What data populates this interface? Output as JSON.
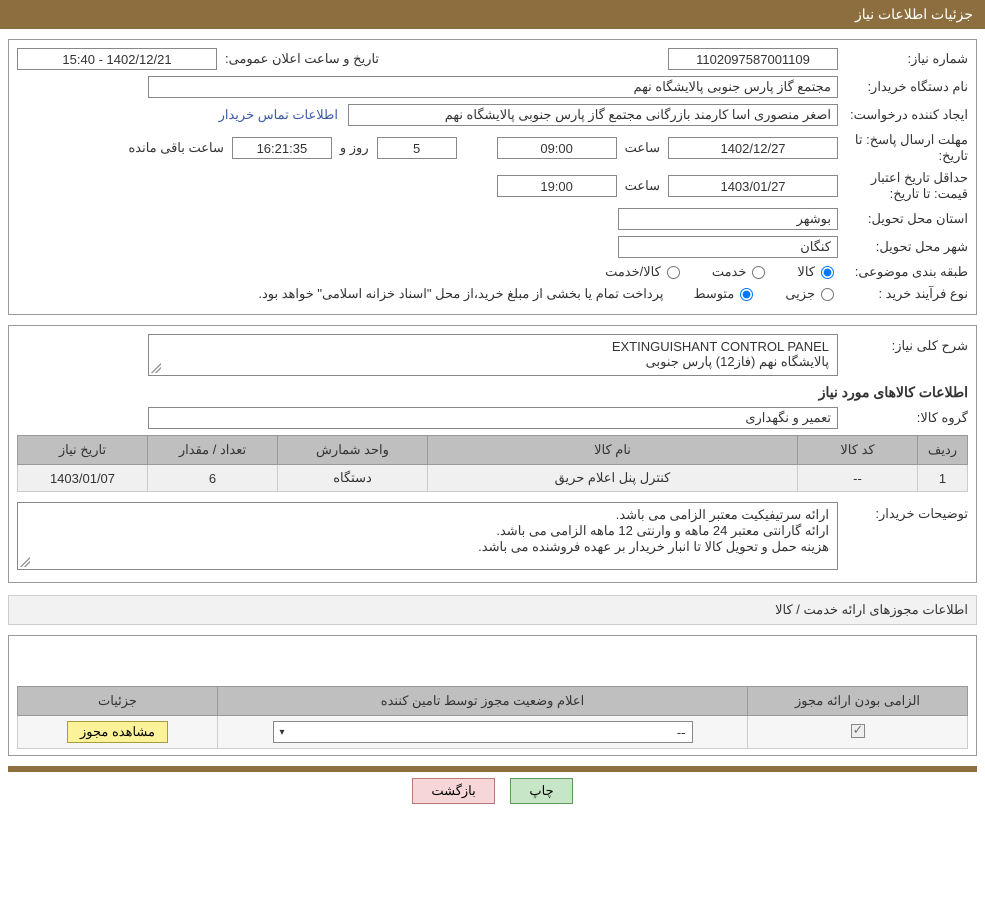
{
  "header": {
    "title": "جزئیات اطلاعات نیاز"
  },
  "labels": {
    "need_no": "شماره نیاز:",
    "announce_dt": "تاریخ و ساعت اعلان عمومی:",
    "buyer_org": "نام دستگاه خریدار:",
    "requester": "ایجاد کننده درخواست:",
    "buyer_contact": "اطلاعات تماس خریدار",
    "reply_deadline": "مهلت ارسال پاسخ:",
    "to_date": "تا تاریخ:",
    "hour": "ساعت",
    "days_and": "روز و",
    "remaining": "ساعت باقی مانده",
    "price_validity": "حداقل تاریخ اعتبار قیمت:",
    "province": "استان محل تحویل:",
    "city": "شهر محل تحویل:",
    "category": "طبقه بندی موضوعی:",
    "cat_goods": "کالا",
    "cat_service": "خدمت",
    "cat_goods_service": "کالا/خدمت",
    "purchase_type": "نوع فرآیند خرید :",
    "pt_partial": "جزیی",
    "pt_medium": "متوسط",
    "payment_note": "پرداخت تمام یا بخشی از مبلغ خرید،از محل \"اسناد خزانه اسلامی\" خواهد بود.",
    "general_desc": "شرح کلی نیاز:",
    "items_title": "اطلاعات کالاهای مورد نیاز",
    "goods_group": "گروه کالا:",
    "buyer_notes": "توضیحات خریدار:",
    "licenses_title": "اطلاعات مجوزهای ارائه خدمت / کالا",
    "view_license": "مشاهده مجوز",
    "print": "چاپ",
    "back": "بازگشت"
  },
  "values": {
    "need_no": "1102097587001109",
    "announce_dt": "1402/12/21 - 15:40",
    "buyer_org": "مجتمع گاز پارس جنوبی  پالایشگاه نهم",
    "requester": "اصغر منصوری اسا کارمند بازرگانی مجتمع گاز پارس جنوبی  پالایشگاه نهم",
    "reply_date": "1402/12/27",
    "reply_time": "09:00",
    "days_left": "5",
    "time_left": "16:21:35",
    "validity_date": "1403/01/27",
    "validity_time": "19:00",
    "province": "بوشهر",
    "city": "کنگان",
    "desc_line1": "EXTINGUISHANT CONTROL PANEL",
    "desc_line2": "پالایشگاه نهم (فاز12) پارس جنوبی",
    "goods_group": "تعمیر و نگهداری",
    "notes_l1": "ارائه سرتیفیکیت معتبر الزامی می باشد.",
    "notes_l2": "ارائه گارانتی معتبر 24 ماهه و وارنتی 12 ماهه الزامی می باشد.",
    "notes_l3": "هزینه حمل و تحویل کالا تا انبار خریدار بر عهده فروشنده می باشد.",
    "dropdown_placeholder": "--"
  },
  "items_table": {
    "headers": {
      "row": "ردیف",
      "code": "کد کالا",
      "name": "نام کالا",
      "unit": "واحد شمارش",
      "qty": "تعداد / مقدار",
      "need_date": "تاریخ نیاز"
    },
    "rows": [
      {
        "row": "1",
        "code": "--",
        "name": "کنترل پنل اعلام حریق",
        "unit": "دستگاه",
        "qty": "6",
        "need_date": "1403/01/07"
      }
    ]
  },
  "license_table": {
    "headers": {
      "mandatory": "الزامی بودن ارائه مجوز",
      "status": "اعلام وضعیت مجوز توسط تامین کننده",
      "details": "جزئیات"
    }
  }
}
